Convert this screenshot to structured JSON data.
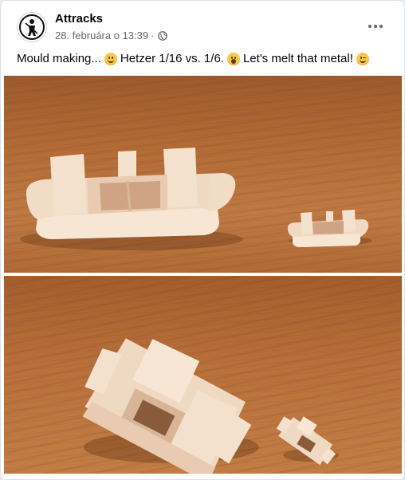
{
  "post": {
    "author": "Attracks",
    "date": "28. februára o 13:39",
    "separator": "·",
    "privacy_icon": "globe-icon",
    "more_icon": "more-horizontal-icon",
    "text_segments": [
      {
        "type": "text",
        "value": "Mould making..."
      },
      {
        "type": "emoji",
        "icon": "smiling-face-emoji"
      },
      {
        "type": "text",
        "value": "Hetzer 1/16 vs. 1/6."
      },
      {
        "type": "emoji",
        "icon": "astonished-face-emoji"
      },
      {
        "type": "text",
        "value": "Let's melt that metal!"
      },
      {
        "type": "emoji",
        "icon": "winking-face-emoji"
      }
    ]
  },
  "photos": [
    {
      "subject": "two 3D-printed track links shown side by side"
    },
    {
      "subject": "two 3D-printed track links shown from behind"
    }
  ],
  "colors": {
    "text_primary": "#050505",
    "text_secondary": "#65676b",
    "card_bg": "#ffffff",
    "wood": "#b36b36",
    "print": "#efd9c3"
  }
}
